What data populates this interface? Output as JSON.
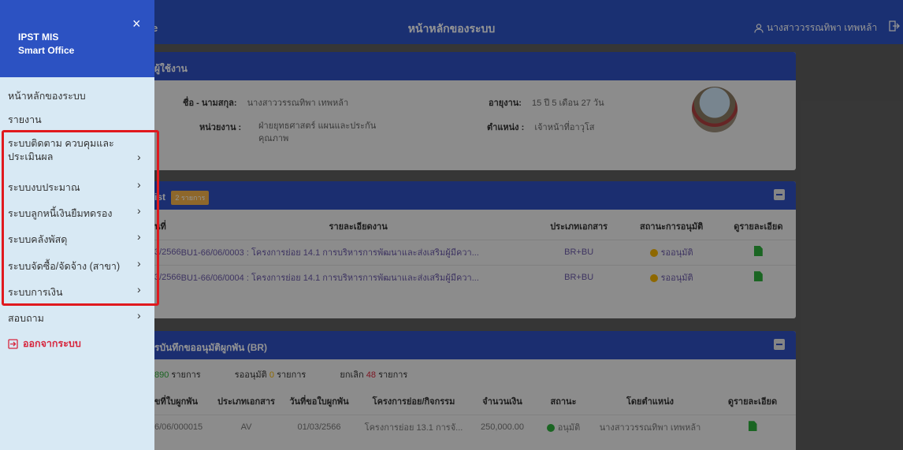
{
  "topbar": {
    "brand_tail": "e",
    "page_title": "หน้าหลักของระบบ",
    "user_name": "นางสาววรรณทิพา เทพหล้า",
    "user_icon": "user-icon",
    "logout_icon": "logout-icon"
  },
  "sidebar": {
    "app_name_line1": "IPST MIS",
    "app_name_line2": "Smart Office",
    "close_glyph": "×",
    "items": [
      {
        "label": "หน้าหลักของระบบ",
        "has_submenu": false
      },
      {
        "label": "รายงาน",
        "has_submenu": false
      },
      {
        "label": "ระบบติดตาม ควบคุมและ",
        "label2": "ประเมินผล",
        "has_submenu": true
      },
      {
        "label": "ระบบงบประมาณ",
        "has_submenu": true
      },
      {
        "label": "ระบบลูกหนี้เงินยืมทดรอง",
        "has_submenu": true
      },
      {
        "label": "ระบบคลังพัสดุ",
        "has_submenu": true
      },
      {
        "label": "ระบบจัดซื้อ/จัดจ้าง (สาขา)",
        "has_submenu": true
      },
      {
        "label": "ระบบการเงิน",
        "has_submenu": true
      },
      {
        "label": "สอบถาม",
        "has_submenu": true
      }
    ],
    "logout_label": "ออกจากระบบ",
    "chevron": "›"
  },
  "profile": {
    "header": "ผู้ใช้งาน",
    "name_label": "ชื่อ - นามสกุล:",
    "name_value": "นางสาววรรณทิพา เทพหล้า",
    "age_label": "อายุงาน:",
    "age_value": "15 ปี 5 เดือน 27 วัน",
    "unit_label": "หน่วยงาน :",
    "unit_value_line1": "ฝ่ายยุทธศาสตร์ แผนและประกัน",
    "unit_value_line2": "คุณภาพ",
    "position_label": "ตำแหน่ง :",
    "position_value": "เจ้าหน้าที่อาวุโส"
  },
  "worklist": {
    "header": "ist",
    "badge": "2 รายการ",
    "columns": [
      "นที่",
      "รายละเอียดงาน",
      "ประเภทเอกสาร",
      "สถานะการอนุมัติ",
      "ดูรายละเอียด"
    ],
    "rows": [
      {
        "date": "3/2566",
        "detail": "BU1-66/06/0003 : โครงการย่อย 14.1 การบริหารการพัฒนาและส่งเสริมผู้มีควา...",
        "type": "BR+BU",
        "status": "รออนุมัติ"
      },
      {
        "date": "3/2566",
        "detail": "BU1-66/06/0004 : โครงการย่อย 14.1 การบริหารการพัฒนาและส่งเสริมผู้มีควา...",
        "type": "BR+BU",
        "status": "รออนุมัติ"
      }
    ],
    "status_color": "#f4b400"
  },
  "br": {
    "header": "รบันทึกขออนุมัติผูกพัน (BR)",
    "summary_total": "890",
    "summary_total_unit": "รายการ",
    "summary_pending_label": "รออนุมัติ",
    "summary_pending_value": "0",
    "summary_pending_unit": "รายการ",
    "summary_cancel_label": "ยกเลิก",
    "summary_cancel_value": "48",
    "summary_cancel_unit": "รายการ",
    "columns": [
      "ขที่ใบผูกพัน",
      "ประเภทเอกสาร",
      "วันที่ขอใบผูกพัน",
      "โครงการย่อย/กิจกรรม",
      "จำนวนเงิน",
      "สถานะ",
      "โดยตำแหน่ง",
      "ดูรายละเอียด"
    ],
    "rows": [
      {
        "no": "6/06/000015",
        "type": "AV",
        "date": "01/03/2566",
        "project": "โครงการย่อย 13.1 การจั...",
        "amount": "250,000.00",
        "status": "อนุมัติ",
        "by": "นางสาววรรณทิพา เทพหล้า"
      }
    ],
    "approved_color": "#2eae3c"
  }
}
